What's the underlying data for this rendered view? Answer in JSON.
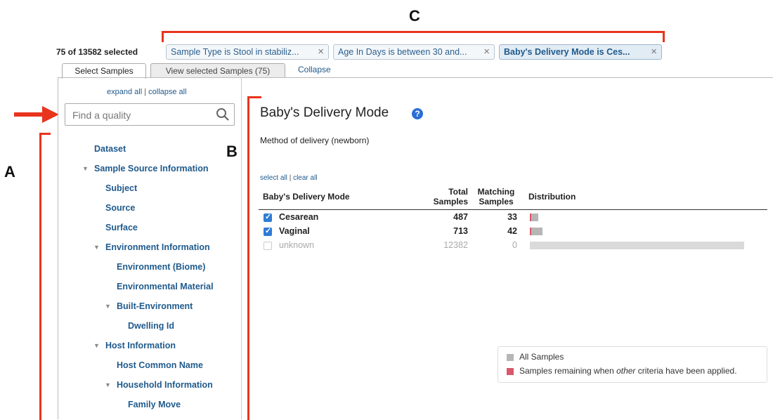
{
  "annotations": {
    "a": "A",
    "b": "B",
    "c": "C"
  },
  "selection": {
    "count_text": "75 of 13582 selected"
  },
  "filters": [
    {
      "label": "Sample Type is Stool in stabiliz...",
      "active": false
    },
    {
      "label": "Age In Days is between 30 and...",
      "active": false
    },
    {
      "label": "Baby's Delivery Mode is Ces...",
      "active": true
    }
  ],
  "chip_close_glyph": "×",
  "tabs": {
    "select_samples": "Select Samples",
    "view_selected": "View selected Samples (75)",
    "collapse": "Collapse"
  },
  "sidebar": {
    "expand_all": "expand all",
    "separator": "|",
    "collapse_all": "collapse all",
    "search_placeholder": "Find a quality",
    "tree": [
      {
        "label": "Dataset"
      },
      {
        "label": "Sample Source Information"
      },
      {
        "label": "Subject"
      },
      {
        "label": "Source"
      },
      {
        "label": "Surface"
      },
      {
        "label": "Environment Information"
      },
      {
        "label": "Environment (Biome)"
      },
      {
        "label": "Environmental Material"
      },
      {
        "label": "Built-Environment"
      },
      {
        "label": "Dwelling Id"
      },
      {
        "label": "Host Information"
      },
      {
        "label": "Host Common Name"
      },
      {
        "label": "Household Information"
      },
      {
        "label": "Family Move"
      }
    ]
  },
  "main": {
    "title": "Baby's Delivery Mode",
    "help_glyph": "?",
    "description": "Method of delivery (newborn)",
    "select_all": "select all",
    "separator": "|",
    "clear_all": "clear all",
    "headers": {
      "mode": "Baby's Delivery Mode",
      "total_line1": "Total",
      "total_line2": "Samples",
      "matching_line1": "Matching",
      "matching_line2": "Samples",
      "distribution": "Distribution"
    },
    "rows": [
      {
        "label": "Cesarean",
        "checked": true,
        "total": "487",
        "matching": "33"
      },
      {
        "label": "Vaginal",
        "checked": true,
        "total": "713",
        "matching": "42"
      },
      {
        "label": "unknown",
        "checked": false,
        "total": "12382",
        "matching": "0"
      }
    ]
  },
  "legend": {
    "all_samples": "All Samples",
    "remaining_prefix": "Samples remaining when ",
    "remaining_em": "other",
    "remaining_suffix": " criteria have been applied.",
    "colors": {
      "all": "#b6b6b6",
      "remaining": "#d9586b"
    }
  }
}
